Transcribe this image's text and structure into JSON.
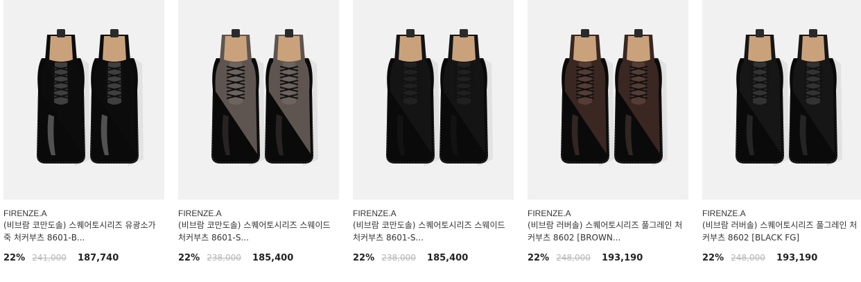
{
  "products": [
    {
      "brand": "FIRENZE.A",
      "name": "(비브람 코만도솔) 스퀘어토시리즈 유광소가죽 처커부츠 8601-B...",
      "discount": "22%",
      "original_price": "241,000",
      "sale_price": "187,740",
      "shoe_color": "#0c0c0c",
      "shoe_highlight": "#6a6a6a",
      "finish": "glossy",
      "image_alt": "black glossy leather chukka boots"
    },
    {
      "brand": "FIRENZE.A",
      "name": "(비브람 코만도솔) 스퀘어토시리즈 스웨이드 처커부츠 8601-S...",
      "discount": "22%",
      "original_price": "238,000",
      "sale_price": "185,400",
      "shoe_color": "#5e5550",
      "shoe_highlight": "#7a716b",
      "finish": "suede",
      "image_alt": "grey-brown suede chukka boots"
    },
    {
      "brand": "FIRENZE.A",
      "name": "(비브람 코만도솔) 스퀘어토시리즈 스웨이드 처커부츠 8601-S...",
      "discount": "22%",
      "original_price": "238,000",
      "sale_price": "185,400",
      "shoe_color": "#141414",
      "shoe_highlight": "#2a2a2a",
      "finish": "suede",
      "image_alt": "black suede chukka boots"
    },
    {
      "brand": "FIRENZE.A",
      "name": "(비브람 러버솔) 스퀘어토시리즈 풀그레인 처커부츠 8602 [BROWN...",
      "discount": "22%",
      "original_price": "248,000",
      "sale_price": "193,190",
      "shoe_color": "#3a2722",
      "shoe_highlight": "#6b4f45",
      "finish": "matte",
      "image_alt": "brown full-grain leather chukka boots"
    },
    {
      "brand": "FIRENZE.A",
      "name": "(비브람 러버솔) 스퀘어토시리즈 풀그레인 처커부츠 8602 [BLACK FG]",
      "discount": "22%",
      "original_price": "248,000",
      "sale_price": "193,190",
      "shoe_color": "#161616",
      "shoe_highlight": "#4a4a4a",
      "finish": "matte",
      "image_alt": "black full-grain leather chukka boots"
    }
  ]
}
